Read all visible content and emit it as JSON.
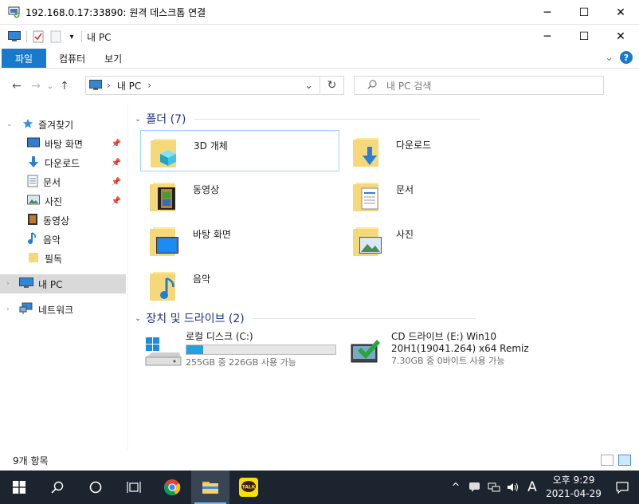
{
  "rdp": {
    "title": "192.168.0.17:33890: 원격 데스크톱 연결",
    "minimize": "─",
    "maximize": "☐",
    "close": "✕"
  },
  "explorer": {
    "title": "내 PC",
    "quick_access_dropdown": "▾",
    "minimize": "─",
    "maximize": "☐",
    "close": "✕"
  },
  "ribbon": {
    "tabs": [
      "파일",
      "컴퓨터",
      "보기"
    ],
    "expand": "⌄",
    "help": "?"
  },
  "nav": {
    "back": "←",
    "forward": "→",
    "recent": "⌄",
    "up": "↑",
    "breadcrumb_sep": "›",
    "location": "내 PC",
    "address_dropdown": "⌄",
    "refresh": "↻",
    "search_placeholder": "내 PC 검색"
  },
  "navpane": {
    "quick_access": "즐겨찾기",
    "items": [
      {
        "label": "바탕 화면",
        "icon": "desktop-icon",
        "pinned": true
      },
      {
        "label": "다운로드",
        "icon": "download-icon",
        "pinned": true
      },
      {
        "label": "문서",
        "icon": "document-icon",
        "pinned": true
      },
      {
        "label": "사진",
        "icon": "picture-icon",
        "pinned": true
      },
      {
        "label": "동영상",
        "icon": "video-icon",
        "pinned": false
      },
      {
        "label": "음악",
        "icon": "music-icon",
        "pinned": false
      },
      {
        "label": "필독",
        "icon": "folder-icon",
        "pinned": false
      }
    ],
    "this_pc": "내 PC",
    "network": "네트워크"
  },
  "content": {
    "folders_header": "폴더 (7)",
    "folders": [
      {
        "name": "3D 개체",
        "icon": "3d-objects-icon"
      },
      {
        "name": "다운로드",
        "icon": "download-icon"
      },
      {
        "name": "동영상",
        "icon": "video-icon"
      },
      {
        "name": "문서",
        "icon": "document-icon"
      },
      {
        "name": "바탕 화면",
        "icon": "desktop-icon"
      },
      {
        "name": "사진",
        "icon": "picture-icon"
      },
      {
        "name": "음악",
        "icon": "music-icon"
      }
    ],
    "drives_header": "장치 및 드라이브 (2)",
    "drives": [
      {
        "name": "로컬 디스크 (C:)",
        "free": "255GB 중 226GB 사용 가능",
        "used_fraction": 0.11,
        "icon": "hard-disk-icon"
      },
      {
        "name_line1": "CD 드라이브 (E:) Win10",
        "name_line2": "20H1(19041.264) x64 Remiz",
        "free": "7.30GB 중 0바이트 사용 가능",
        "icon": "cd-drive-icon"
      }
    ]
  },
  "status": {
    "items": "9개 항목"
  },
  "taskbar": {
    "time_period": "오후 9:29",
    "date": "2021-04-29",
    "ime": "A"
  },
  "colors": {
    "accent": "#1979ca",
    "header_text": "#1e3287",
    "drive_bar": "#26a0da",
    "taskbar": "#1c2430"
  }
}
